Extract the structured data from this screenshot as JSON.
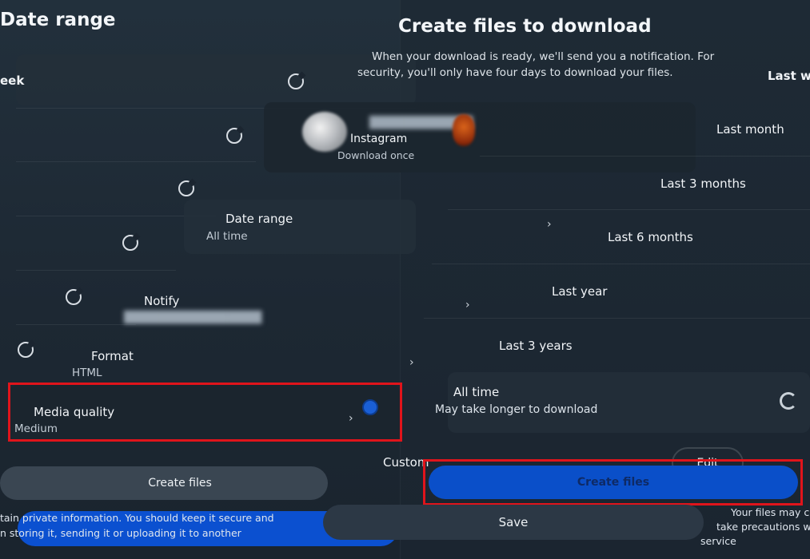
{
  "left_panel": {
    "heading": "Date range",
    "partial_item": "eek",
    "options": [
      "Last week",
      "Last month",
      "Last 3 months",
      "Last 6 months",
      "Last year"
    ]
  },
  "dialog": {
    "title": "Create files to download",
    "description_line1": "When your download is ready, we'll send you a notification. For",
    "description_line2": "security, you'll only have four days to download your files.",
    "account": {
      "name": "Instagram",
      "frequency": "Download once"
    },
    "settings": [
      {
        "label": "Date range",
        "value": "All time"
      },
      {
        "label": "Notify",
        "value": ""
      },
      {
        "label": "Format",
        "value": "HTML"
      },
      {
        "label": "Media quality",
        "value": "Medium"
      }
    ],
    "create_button": "Create files"
  },
  "right_panel": {
    "partial_option": "Last w",
    "options": [
      "Last month",
      "Last 3 months",
      "Last 6 months",
      "Last year",
      "Last 3 years"
    ],
    "all_time": {
      "label": "All time",
      "sub": "May take longer to download"
    },
    "custom_label": "Custom",
    "edit_button": "Edit",
    "create_button": "Create files",
    "save_button": "Save",
    "footer_line1": "Your files may co",
    "footer_line2": "take precautions w",
    "footer_line3": "service"
  },
  "bottom_text": {
    "line1": "tain private information. You should keep it secure and",
    "line2": "n storing it, sending it or uploading it to another"
  },
  "colors": {
    "highlight": "#e0141b",
    "primary": "#0a4fc9",
    "background": "#1b2530"
  }
}
